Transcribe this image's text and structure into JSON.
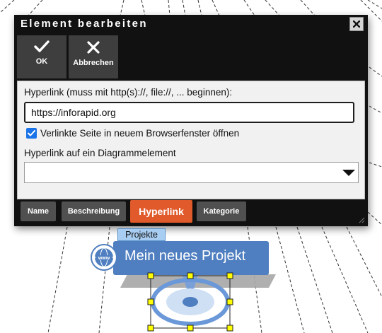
{
  "dialog": {
    "title": "Element bearbeiten",
    "toolbar": {
      "ok_label": "OK",
      "cancel_label": "Abbrechen"
    },
    "hyperlink_label": "Hyperlink (muss mit http(s)://, file://, ... beginnen):",
    "hyperlink_value": "https://inforapid.org",
    "open_new_window_label": "Verlinkte Seite in neuem Browserfenster öffnen",
    "open_new_window_checked": true,
    "diagram_link_label": "Hyperlink auf ein Diagrammelement",
    "diagram_link_value": "",
    "tabs": [
      {
        "label": "Name",
        "active": false
      },
      {
        "label": "Beschreibung",
        "active": false
      },
      {
        "label": "Hyperlink",
        "active": true
      },
      {
        "label": "Kategorie",
        "active": false
      }
    ]
  },
  "diagram": {
    "parent_label": "Projekte",
    "node_title": "Mein neues Projekt",
    "www_icon_text": "www"
  },
  "colors": {
    "dialog_bg": "#111111",
    "toolbar_button": "#3e3e3e",
    "active_tab": "#e05a2b",
    "checkbox": "#1a73e8",
    "node_blue": "#4f7fc0",
    "handle_yellow": "#ffff00"
  }
}
